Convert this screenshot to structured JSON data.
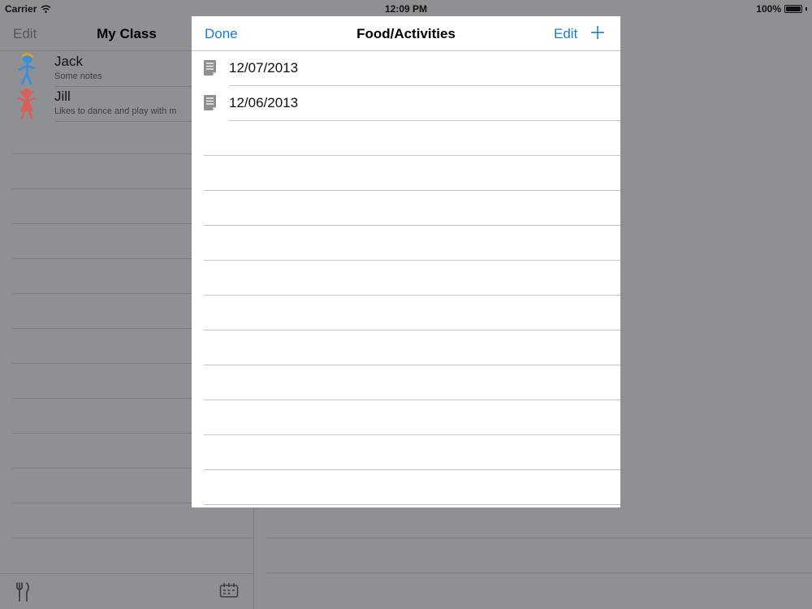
{
  "status_bar": {
    "carrier": "Carrier",
    "time": "12:09 PM",
    "battery": "100%",
    "battery_level": 1.0
  },
  "master": {
    "edit_label": "Edit",
    "title": "My Class",
    "students": [
      {
        "name": "Jack",
        "note": "Some notes",
        "avatar": "boy-figure-icon",
        "avatar_color": "#3a8fd8"
      },
      {
        "name": "Jill",
        "note": "Likes to dance and play with m",
        "avatar": "girl-figure-icon",
        "avatar_color": "#d8605a"
      }
    ],
    "toolbar": {
      "left_icon": "fork-knife-icon",
      "right_icon": "calendar-icon"
    }
  },
  "modal": {
    "done_label": "Done",
    "title": "Food/Activities",
    "edit_label": "Edit",
    "add_icon": "plus-icon",
    "entries": [
      {
        "date": "12/07/2013",
        "icon": "document-icon"
      },
      {
        "date": "12/06/2013",
        "icon": "document-icon"
      }
    ]
  },
  "colors": {
    "accent": "#1a7ae0",
    "dimmed_background": "#8f9094"
  }
}
